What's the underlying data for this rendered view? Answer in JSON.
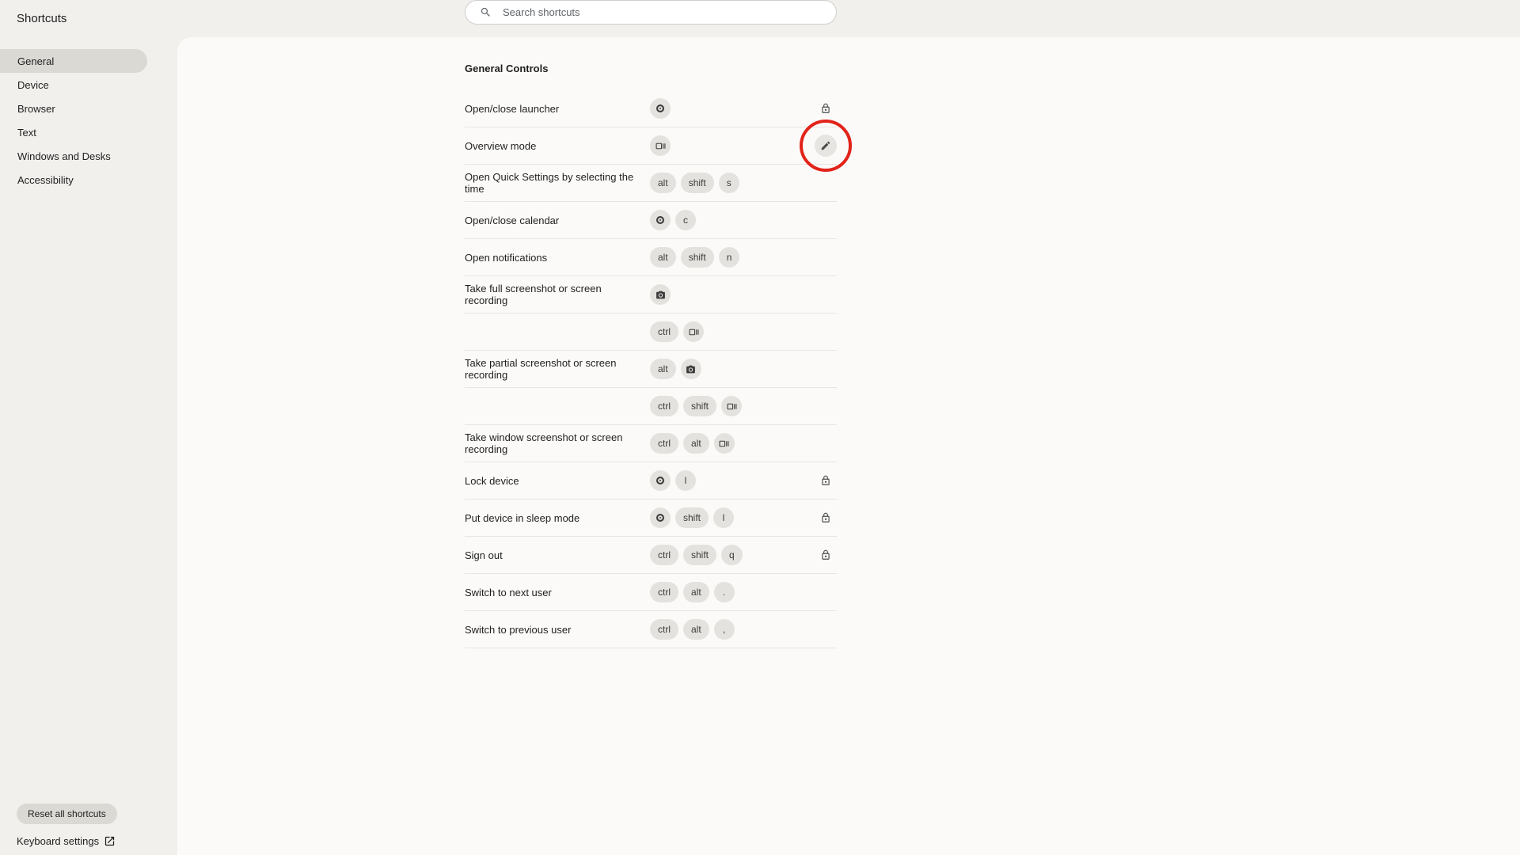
{
  "page_title": "Shortcuts",
  "search": {
    "placeholder": "Search shortcuts"
  },
  "sidebar": {
    "items": [
      {
        "label": "General",
        "active": true
      },
      {
        "label": "Device",
        "active": false
      },
      {
        "label": "Browser",
        "active": false
      },
      {
        "label": "Text",
        "active": false
      },
      {
        "label": "Windows and Desks",
        "active": false
      },
      {
        "label": "Accessibility",
        "active": false
      }
    ],
    "reset_label": "Reset all shortcuts",
    "keyboard_settings_label": "Keyboard settings"
  },
  "section_title": "General Controls",
  "rows": [
    {
      "label": "Open/close launcher",
      "keys": [
        [
          "launcher"
        ]
      ],
      "action": "lock"
    },
    {
      "label": "Overview mode",
      "keys": [
        [
          "overview"
        ]
      ],
      "action": "edit",
      "highlight": true
    },
    {
      "label": "Open Quick Settings by selecting the time",
      "keys": [
        [
          "alt",
          "shift",
          "s"
        ]
      ],
      "action": null
    },
    {
      "label": "Open/close calendar",
      "keys": [
        [
          "launcher",
          "c"
        ]
      ],
      "action": null
    },
    {
      "label": "Open notifications",
      "keys": [
        [
          "alt",
          "shift",
          "n"
        ]
      ],
      "action": null
    },
    {
      "label": "Take full screenshot or screen recording",
      "keys": [
        [
          "screenshot"
        ],
        [
          "ctrl",
          "overview"
        ]
      ],
      "action": null
    },
    {
      "label": "Take partial screenshot or screen recording",
      "keys": [
        [
          "alt",
          "screenshot"
        ],
        [
          "ctrl",
          "shift",
          "overview"
        ]
      ],
      "action": null
    },
    {
      "label": "Take window screenshot or screen recording",
      "keys": [
        [
          "ctrl",
          "alt",
          "overview"
        ]
      ],
      "action": null
    },
    {
      "label": "Lock device",
      "keys": [
        [
          "launcher",
          "l"
        ]
      ],
      "action": "lock"
    },
    {
      "label": "Put device in sleep mode",
      "keys": [
        [
          "launcher",
          "shift",
          "l"
        ]
      ],
      "action": "lock"
    },
    {
      "label": "Sign out",
      "keys": [
        [
          "ctrl",
          "shift",
          "q"
        ]
      ],
      "action": "lock"
    },
    {
      "label": "Switch to next user",
      "keys": [
        [
          "ctrl",
          "alt",
          "."
        ]
      ],
      "action": null
    },
    {
      "label": "Switch to previous user",
      "keys": [
        [
          "ctrl",
          "alt",
          ","
        ]
      ],
      "action": null
    }
  ]
}
